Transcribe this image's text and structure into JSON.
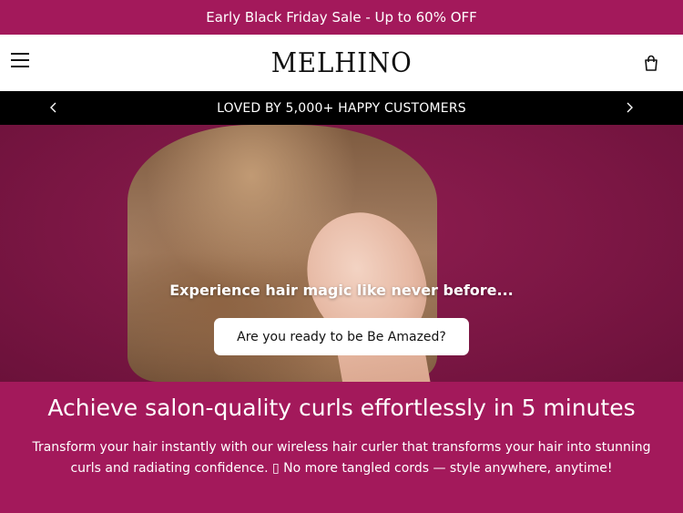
{
  "announcement": {
    "text": "Early Black Friday Sale - Up to 60% OFF"
  },
  "header": {
    "logo_text": "MELHINO",
    "menu_icon": "hamburger-menu-icon",
    "cart_icon": "shopping-bag-icon"
  },
  "marquee": {
    "text": "LOVED BY 5,000+ HAPPY CUSTOMERS",
    "prev_icon": "chevron-left-icon",
    "next_icon": "chevron-right-icon"
  },
  "hero": {
    "tagline": "Experience hair magic like never before...",
    "cta_label": "Are you ready to be Be Amazed?"
  },
  "promo": {
    "title": "Achieve salon-quality curls effortlessly in 5 minutes",
    "description": "Transform your hair instantly with our wireless hair curler that transforms your hair into stunning curls and radiating confidence. ▯ No more tangled cords — style anywhere, anytime!"
  },
  "colors": {
    "brand": "#a3195b",
    "marquee_bg": "#000000",
    "header_bg": "#ffffff"
  }
}
